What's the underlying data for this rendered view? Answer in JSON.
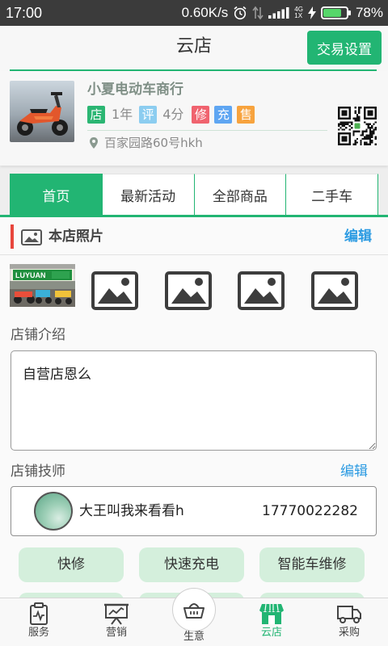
{
  "status_bar": {
    "time": "17:00",
    "speed": "0.60K/s",
    "network": "4G",
    "network_sub": "1X",
    "battery": "78%",
    "battery_level": 0.78,
    "icons": [
      "alarm-icon",
      "data-transfer-icon",
      "signal-icon",
      "charging-icon",
      "battery-icon"
    ]
  },
  "header": {
    "title": "云店",
    "settings_button": "交易设置"
  },
  "store": {
    "photo": "scooter-photo",
    "name": "小夏电动车商行",
    "badge_store": "店",
    "years": "1年",
    "badge_rating": "评",
    "rating": "4分",
    "service_badges": [
      "修",
      "充",
      "售"
    ],
    "address_icon": "location-pin-icon",
    "address": "百家园路60号hkh",
    "qr": "qr-code"
  },
  "tabs": [
    {
      "label": "首页",
      "active": true
    },
    {
      "label": "最新活动",
      "active": false
    },
    {
      "label": "全部商品",
      "active": false
    },
    {
      "label": "二手车",
      "active": false
    }
  ],
  "photos": {
    "icon": "picture-icon",
    "title": "本店照片",
    "edit": "编辑",
    "store_photo_sign": "LUYUAN",
    "placeholder_icon": "image-placeholder-icon"
  },
  "intro": {
    "label": "店铺介绍",
    "text": "自营店恩么"
  },
  "technicians": {
    "label": "店铺技师",
    "edit": "编辑",
    "items": [
      {
        "name": "大王叫我来看看h",
        "phone": "17770022282"
      }
    ]
  },
  "skills": [
    "快修",
    "快速充电",
    "智能车维修"
  ],
  "bottom_nav": [
    {
      "label": "服务",
      "icon": "clipboard-icon",
      "active": false
    },
    {
      "label": "营销",
      "icon": "presentation-board-icon",
      "active": false
    },
    {
      "label": "生意",
      "icon": "basket-icon",
      "active": false
    },
    {
      "label": "云店",
      "icon": "storefront-icon",
      "active": true
    },
    {
      "label": "采购",
      "icon": "truck-icon",
      "active": false
    }
  ],
  "colors": {
    "brand_green": "#22b573",
    "edit_blue": "#2a9ae2",
    "section_marker_red": "#e8453c",
    "skill_tag_bg": "#d4efdc",
    "badge_store": "#2bb673",
    "badge_rating": "#8ccdf0",
    "badge_repair": "#f0636f",
    "badge_charge": "#5fa6f2",
    "badge_sale": "#f7a33e"
  }
}
